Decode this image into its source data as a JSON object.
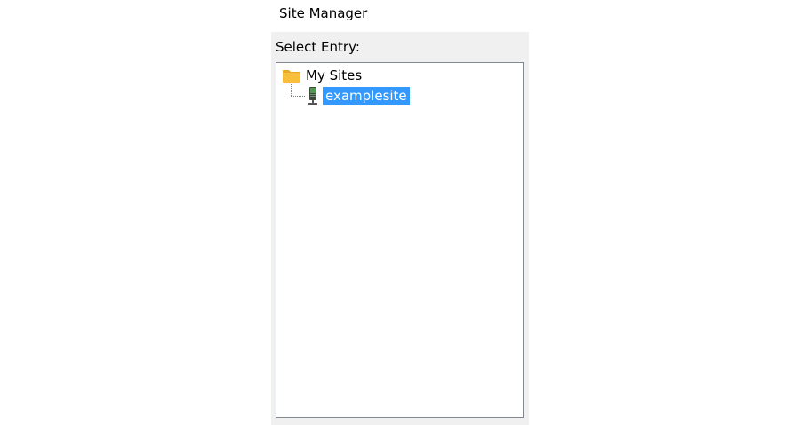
{
  "window": {
    "title": "Site Manager"
  },
  "panel": {
    "select_label": "Select Entry:"
  },
  "tree": {
    "root": {
      "label": "My Sites",
      "icon": "folder-icon"
    },
    "children": [
      {
        "label": "examplesite",
        "icon": "server-icon",
        "selected": true
      }
    ]
  },
  "colors": {
    "selection_bg": "#3399ff",
    "selection_fg": "#ffffff",
    "panel_bg": "#f0f0f0",
    "tree_border": "#828790",
    "folder": "#f8c03a"
  }
}
